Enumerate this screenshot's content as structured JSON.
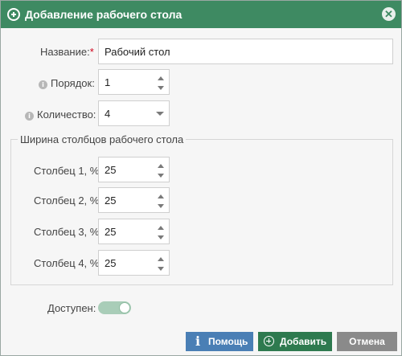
{
  "dialog": {
    "title": "Добавление рабочего стола",
    "close_icon": "close-icon",
    "title_icon": "add-circle-icon"
  },
  "form": {
    "name": {
      "label": "Название:",
      "required_mark": "*",
      "value": "Рабочий стол"
    },
    "order": {
      "label": "Порядок:",
      "value": "1",
      "info_icon": "info-icon"
    },
    "count": {
      "label": "Количество:",
      "value": "4",
      "info_icon": "info-icon"
    },
    "columns_group": {
      "legend": "Ширина столбцов рабочего стола",
      "columns": [
        {
          "label": "Столбец 1, %:",
          "value": "25"
        },
        {
          "label": "Столбец 2, %:",
          "value": "25"
        },
        {
          "label": "Столбец 3, %:",
          "value": "25"
        },
        {
          "label": "Столбец 4, %:",
          "value": "25"
        }
      ]
    },
    "available": {
      "label": "Доступен:",
      "state": "on"
    }
  },
  "buttons": {
    "help": "Помощь",
    "add": "Добавить",
    "cancel": "Отмена"
  },
  "colors": {
    "header": "#3e8a62",
    "help_button": "#4a7fb5",
    "add_button": "#2e7a4f",
    "cancel_button": "#8a8a8a",
    "toggle_on": "#a9cdb8"
  }
}
